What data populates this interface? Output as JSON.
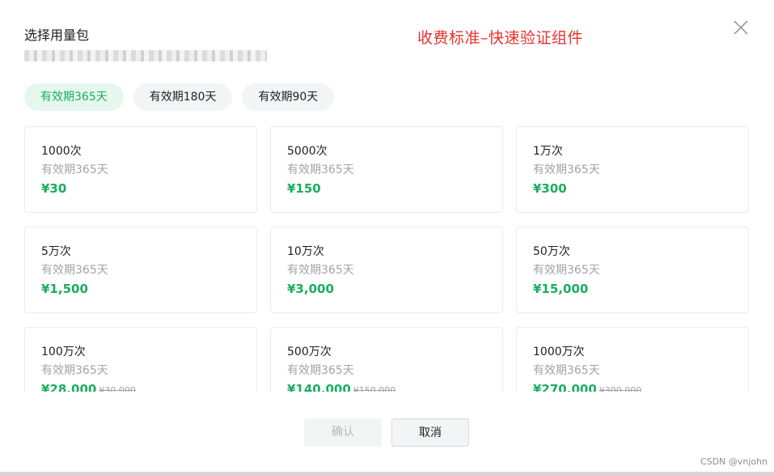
{
  "dialog": {
    "title": "选择用量包",
    "annotation": "收费标准–快速验证组件"
  },
  "tabs": [
    {
      "label": "有效期365天",
      "active": true
    },
    {
      "label": "有效期180天",
      "active": false
    },
    {
      "label": "有效期90天",
      "active": false
    }
  ],
  "packages": [
    {
      "name": "1000次",
      "validity": "有效期365天",
      "price": "¥30",
      "original": ""
    },
    {
      "name": "5000次",
      "validity": "有效期365天",
      "price": "¥150",
      "original": ""
    },
    {
      "name": "1万次",
      "validity": "有效期365天",
      "price": "¥300",
      "original": ""
    },
    {
      "name": "5万次",
      "validity": "有效期365天",
      "price": "¥1,500",
      "original": ""
    },
    {
      "name": "10万次",
      "validity": "有效期365天",
      "price": "¥3,000",
      "original": ""
    },
    {
      "name": "50万次",
      "validity": "有效期365天",
      "price": "¥15,000",
      "original": ""
    },
    {
      "name": "100万次",
      "validity": "有效期365天",
      "price": "¥28,000",
      "original": "¥30,000"
    },
    {
      "name": "500万次",
      "validity": "有效期365天",
      "price": "¥140,000",
      "original": "¥150,000"
    },
    {
      "name": "1000万次",
      "validity": "有效期365天",
      "price": "¥270,000",
      "original": "¥300,000"
    }
  ],
  "buttons": {
    "confirm": "确认",
    "cancel": "取消"
  },
  "watermark": "CSDN @vnjohn",
  "colors": {
    "accent": "#1aad5f",
    "annotation": "#e5332e"
  }
}
